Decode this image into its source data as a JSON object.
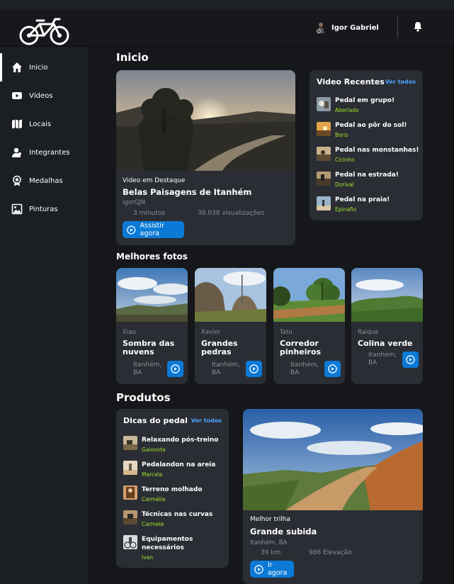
{
  "header": {
    "user_name": "Igor Gabriel"
  },
  "sidebar": {
    "items": [
      {
        "label": "Inicio",
        "icon": "home-icon"
      },
      {
        "label": "Vídeos",
        "icon": "youtube-icon"
      },
      {
        "label": "Locais",
        "icon": "map-icon"
      },
      {
        "label": "Integrantes",
        "icon": "users-icon"
      },
      {
        "label": "Medalhas",
        "icon": "medal-icon"
      },
      {
        "label": "Pinturas",
        "icon": "image-icon"
      }
    ]
  },
  "main": {
    "title": "Inicio",
    "featured": {
      "tag": "Video em Destaque",
      "title": "Belas Paisagens de Itanhém",
      "author": "IgorGJN",
      "duration": "3 minutos",
      "views": "38.038 visualizações",
      "button": "Assistir agora"
    },
    "recent": {
      "title": "Video Recentes",
      "more": "Ver todos",
      "items": [
        {
          "title": "Pedal em grupo!",
          "author": "Aberlado"
        },
        {
          "title": "Pedal ao pôr do sol!",
          "author": "Boris"
        },
        {
          "title": "Pedal nas monstanhas!",
          "author": "Cicinho"
        },
        {
          "title": "Pedal na estrada!",
          "author": "Dorival"
        },
        {
          "title": "Pedal na praia!",
          "author": "Epinafio"
        }
      ]
    },
    "best_photos": {
      "title": "Melhores fotos",
      "items": [
        {
          "author": "Xiau",
          "title": "Sombra das nuvens",
          "location": "Itanhém, BA"
        },
        {
          "author": "Xavier",
          "title": "Grandes pedras",
          "location": "Itanhém, BA"
        },
        {
          "author": "Tatu",
          "title": "Corredor pinheiros",
          "location": "Itanhém, BA"
        },
        {
          "author": "Raique",
          "title": "Colina verde",
          "location": "Itanhém, BA"
        }
      ]
    },
    "products": {
      "title": "Produtos",
      "tips": {
        "title": "Dicas do pedal",
        "more": "Ver todos",
        "items": [
          {
            "title": "Relaxando pós-treino",
            "author": "Gaiovota"
          },
          {
            "title": "Pedalandon na areia",
            "author": "Marcela"
          },
          {
            "title": "Terreno molhado",
            "author": "Carmélia"
          },
          {
            "title": "Técnicas nas curvas",
            "author": "Carmela"
          },
          {
            "title": "Equipamentos necessários",
            "author": "Ivan"
          }
        ]
      },
      "trail": {
        "tag": "Melhor trilha",
        "title": "Grande subida",
        "location": "Itanhém, BA",
        "distance": "39 km",
        "elevation": "986 Elevação",
        "button": "Ir agora"
      }
    }
  },
  "colors": {
    "accent": "#0b7ad6",
    "link": "#4da3ff",
    "author": "#a6e22e",
    "card": "#2a2d33"
  }
}
